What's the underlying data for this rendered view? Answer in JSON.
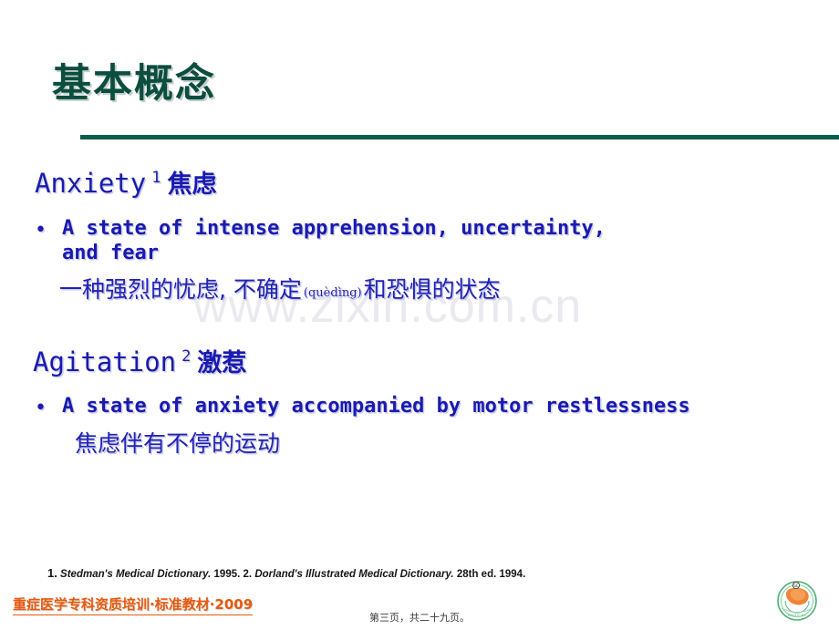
{
  "slide": {
    "title": "基本概念",
    "title_color": "#0b4d3e",
    "rule_color": "#0b5e4a",
    "accent_text_color": "#1a1ab0",
    "brand_color": "#e8590c",
    "background": "#ffffff"
  },
  "watermark": {
    "text": "www.zixin.com.cn",
    "color": "#e9e9ef"
  },
  "content": {
    "terms": [
      {
        "term": "Anxiety",
        "reference_mark": "1",
        "chinese": "焦虑",
        "bullet_marker": "•",
        "definition_en": "A state of intense apprehension, uncertainty,\nand fear",
        "definition_cn_pre": "一种强烈的忧虑, 不确定",
        "definition_cn_pinyin": "(quèdìng)",
        "definition_cn_post": "和恐惧的状态"
      },
      {
        "term": "Agitation",
        "reference_mark": "2",
        "chinese": "激惹",
        "bullet_marker": "•",
        "definition_en": "A state of anxiety accompanied by motor restlessness",
        "definition_cn_pre": "焦虑伴有不停的运动",
        "definition_cn_pinyin": "",
        "definition_cn_post": ""
      }
    ]
  },
  "footer": {
    "footnote_num1": "1.",
    "footnote_src1": "Stedman's Medical Dictionary.",
    "footnote_year1": "1995.",
    "footnote_num2": "2.",
    "footnote_src2": "Dorland's Illustrated Medical Dictionary.",
    "footnote_year2": "28th ed. 1994.",
    "brand": "重症医学专科资质培训·标准教材·2009",
    "page_number": "第三页，共二十九页。",
    "logo_name": "circular-institution-emblem"
  }
}
